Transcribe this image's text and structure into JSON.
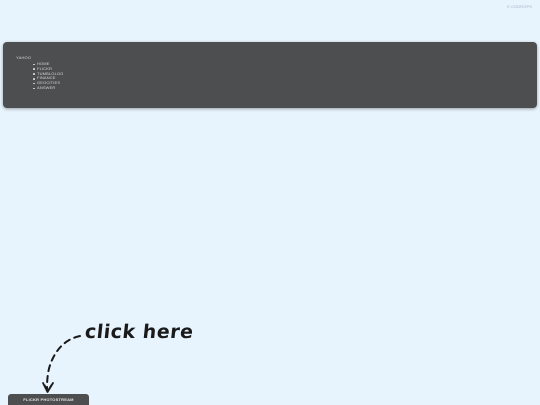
{
  "header": {
    "link_label": "© CODROPS"
  },
  "panel": {
    "title": "YAHOO",
    "nav_items": [
      {
        "label": "HOME"
      },
      {
        "label": "FLICKR"
      },
      {
        "label": "TUMBLOLOG"
      },
      {
        "label": "FINANCE"
      },
      {
        "label": "GEOCITIES"
      },
      {
        "label": "ANSWER"
      }
    ]
  },
  "annotation": {
    "text": "click here",
    "icon": "dashed-arrow-down"
  },
  "footer_button": {
    "label": "FLICKR PHOTOSTREAM"
  },
  "colors": {
    "background": "#e8f4fd",
    "panel": "#4c4e50",
    "panel_text": "#d6d8da",
    "link": "#9fb2c4"
  }
}
